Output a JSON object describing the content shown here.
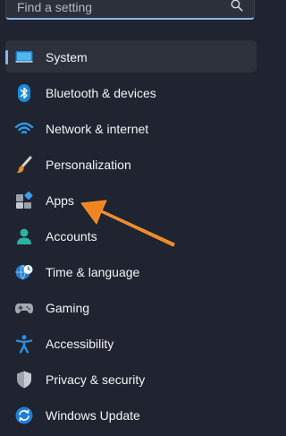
{
  "search": {
    "placeholder": "Find a setting",
    "icon": "search-icon"
  },
  "nav": {
    "selected": "System",
    "items": [
      {
        "label": "System",
        "icon": "monitor-icon"
      },
      {
        "label": "Bluetooth & devices",
        "icon": "bluetooth-icon"
      },
      {
        "label": "Network & internet",
        "icon": "wifi-icon"
      },
      {
        "label": "Personalization",
        "icon": "paintbrush-icon"
      },
      {
        "label": "Apps",
        "icon": "apps-icon"
      },
      {
        "label": "Accounts",
        "icon": "person-icon"
      },
      {
        "label": "Time & language",
        "icon": "globe-clock-icon"
      },
      {
        "label": "Gaming",
        "icon": "gamepad-icon"
      },
      {
        "label": "Accessibility",
        "icon": "accessibility-icon"
      },
      {
        "label": "Privacy & security",
        "icon": "shield-icon"
      },
      {
        "label": "Windows Update",
        "icon": "update-icon"
      }
    ]
  },
  "annotation": {
    "icon": "arrow-icon",
    "color": "#f2841f",
    "target": "Apps"
  },
  "colors": {
    "background": "#1f2430",
    "selected_background": "#2c313c",
    "accent": "#8fb4e6",
    "text": "#f3f4f6"
  }
}
